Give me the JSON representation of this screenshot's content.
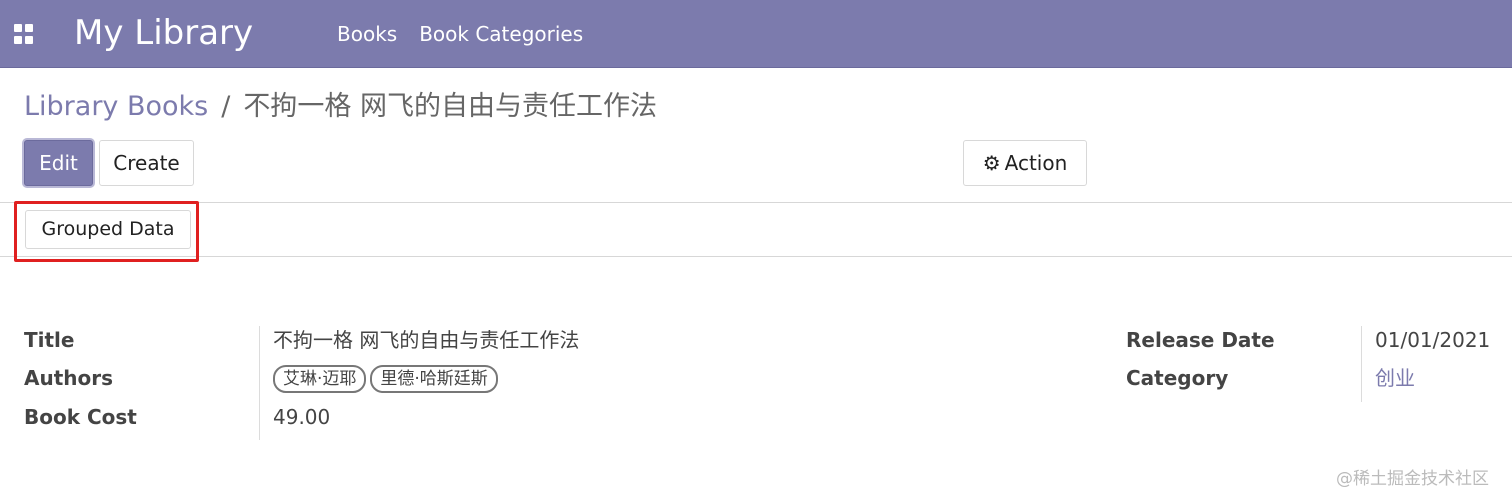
{
  "navbar": {
    "app_icon": "apps-grid-icon",
    "brand": "My Library",
    "menu": [
      {
        "label": "Books"
      },
      {
        "label": "Book Categories"
      }
    ],
    "background": "#7c7bad"
  },
  "breadcrumb": {
    "parent": "Library Books",
    "separator": "/",
    "current": "不拘一格 网飞的自由与责任工作法"
  },
  "buttons": {
    "edit": "Edit",
    "create": "Create",
    "action": "Action",
    "action_icon": "gear-icon",
    "grouped_data": "Grouped Data"
  },
  "form": {
    "title_label": "Title",
    "title_value": "不拘一格 网飞的自由与责任工作法",
    "authors_label": "Authors",
    "authors": [
      "艾琳·迈耶",
      "里德·哈斯廷斯"
    ],
    "cost_label": "Book Cost",
    "cost_value": "49.00",
    "release_label": "Release Date",
    "release_value": "01/01/2021",
    "category_label": "Category",
    "category_value": "创业"
  },
  "watermark": "@稀土掘金技术社区",
  "colors": {
    "accent": "#7c7bad",
    "highlight": "#e02020"
  }
}
